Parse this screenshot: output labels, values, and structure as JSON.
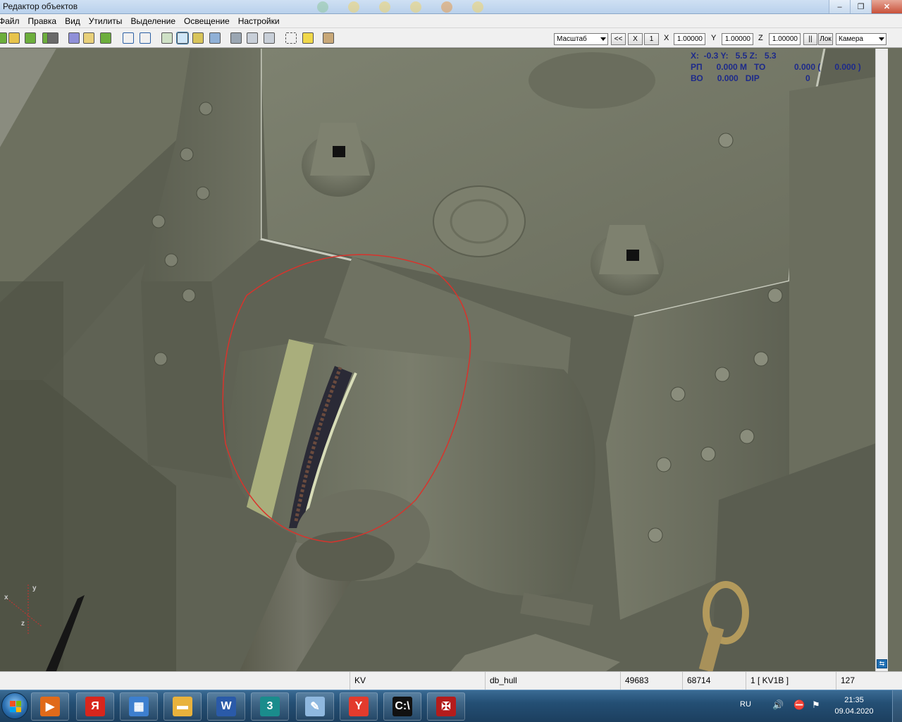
{
  "window": {
    "title": "Редактор объектов"
  },
  "menu": [
    "Файл",
    "Правка",
    "Вид",
    "Утилиты",
    "Выделение",
    "Освещение",
    "Настройки"
  ],
  "toolbar": {
    "mode_select": "Масштаб",
    "btn_back": "<<",
    "btn_x": "X",
    "btn_1": "1",
    "label_x": "X",
    "value_x": "1.00000",
    "label_y": "Y",
    "value_y": "1.00000",
    "label_z": "Z",
    "value_z": "1.00000",
    "btn_pause": "||",
    "btn_lok": "Лок",
    "camera_select": "Камера"
  },
  "readout": {
    "row1": "X:  -0.3 Y:   5.5 Z:   5.3",
    "row2_a": "РП      0.000 М   ТО",
    "row2_b": "0.000 (      0.000 )",
    "row3_a": "ВО      0.000   DIP",
    "row3_b": "0"
  },
  "axis_labels": {
    "x": "x",
    "y": "y",
    "z": "z"
  },
  "status": {
    "model": "KV",
    "part": "db_hull",
    "val1": "49683",
    "val2": "68714",
    "lod": "1 [ KV1B ]",
    "val3": "127"
  },
  "taskbar": {
    "apps": [
      {
        "icon": "media-player-icon",
        "color": "#e06a1a",
        "glyph": "▶"
      },
      {
        "icon": "yandex-icon",
        "color": "#d8261d",
        "glyph": "Я"
      },
      {
        "icon": "control-panel-icon",
        "color": "#3d7fcf",
        "glyph": "▦"
      },
      {
        "icon": "folder-icon",
        "color": "#e8b23c",
        "glyph": "▬"
      },
      {
        "icon": "word-icon",
        "color": "#2a5aa8",
        "glyph": "W"
      },
      {
        "icon": "3dsmax-icon",
        "color": "#1a8c8c",
        "glyph": "3"
      },
      {
        "icon": "paint-icon",
        "color": "#8fb8df",
        "glyph": "✎"
      },
      {
        "icon": "yandex-browser-icon",
        "color": "#e33b2d",
        "glyph": "Y"
      },
      {
        "icon": "cmd-icon",
        "color": "#111111",
        "glyph": "C:\\"
      },
      {
        "icon": "game-icon",
        "color": "#b41c1c",
        "glyph": "✠"
      }
    ],
    "lang": "RU",
    "time": "21:35",
    "date": "09.04.2020"
  }
}
